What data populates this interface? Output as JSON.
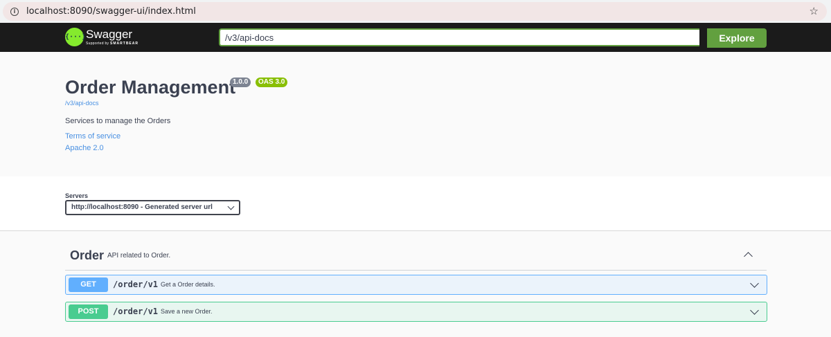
{
  "browser": {
    "url": "localhost:8090/swagger-ui/index.html",
    "info_icon": "info-icon",
    "bookmark_icon": "star-icon"
  },
  "topbar": {
    "logo_symbol": "{···}",
    "logo_text": "Swagger",
    "logo_sub_prefix": "Supported by",
    "logo_sub_brand": "SMARTBEAR",
    "search_value": "/v3/api-docs",
    "explore_label": "Explore"
  },
  "info": {
    "title": "Order Management",
    "version": "1.0.0",
    "oas": "OAS 3.0",
    "spec_url": "/v3/api-docs",
    "description": "Services to manage the Orders",
    "terms_label": "Terms of service",
    "license_label": "Apache 2.0"
  },
  "servers": {
    "label": "Servers",
    "selected": "http://localhost:8090 - Generated server url"
  },
  "tag": {
    "name": "Order",
    "description": "API related to Order."
  },
  "operations": [
    {
      "method": "GET",
      "path": "/order/v1",
      "summary": "Get a Order details."
    },
    {
      "method": "POST",
      "path": "/order/v1",
      "summary": "Save a new Order."
    }
  ],
  "colors": {
    "topbar_bg": "#1b1b1b",
    "swagger_green": "#85ea2d",
    "explore_green": "#62a03f",
    "get_blue": "#61affe",
    "post_green": "#49cc90",
    "version_badge": "#7d8492",
    "oas_badge": "#89bf04",
    "link_blue": "#4990e2"
  }
}
